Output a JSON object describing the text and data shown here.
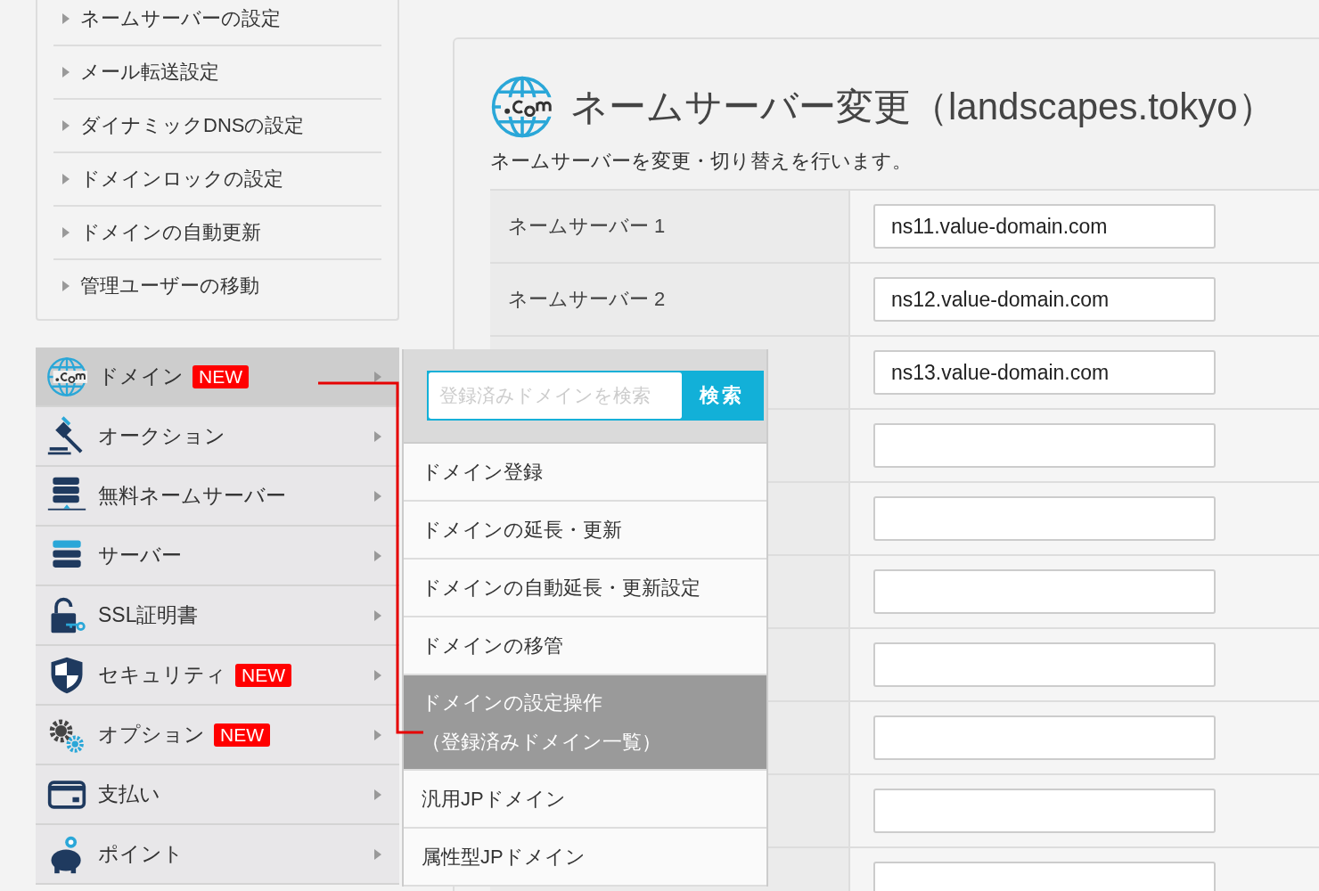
{
  "sidebar_links": [
    {
      "label": "ネームサーバーの設定"
    },
    {
      "label": "メール転送設定"
    },
    {
      "label": "ダイナミックDNSの設定"
    },
    {
      "label": "ドメインロックの設定"
    },
    {
      "label": "ドメインの自動更新"
    },
    {
      "label": "管理ユーザーの移動"
    }
  ],
  "main_menu": [
    {
      "label": "ドメイン",
      "badge": "NEW",
      "selected": true
    },
    {
      "label": "オークション",
      "selected": false
    },
    {
      "label": "無料ネームサーバー",
      "selected": false
    },
    {
      "label": "サーバー",
      "selected": false
    },
    {
      "label": "SSL証明書",
      "selected": false
    },
    {
      "label": "セキュリティ",
      "badge": "NEW",
      "selected": false
    },
    {
      "label": "オプション",
      "badge": "NEW",
      "selected": false
    },
    {
      "label": "支払い",
      "selected": false
    },
    {
      "label": "ポイント",
      "selected": false
    }
  ],
  "submenu": {
    "search": {
      "placeholder": "登録済みドメインを検索",
      "button": "検索"
    },
    "items": [
      {
        "label": "ドメイン登録",
        "selected": false
      },
      {
        "label": "ドメインの延長・更新",
        "selected": false
      },
      {
        "label": "ドメインの自動延長・更新設定",
        "selected": false
      },
      {
        "label": "ドメインの移管",
        "selected": false
      },
      {
        "label": "ドメインの設定操作",
        "note": "（登録済みドメイン一覧）",
        "selected": true
      },
      {
        "label": "汎用JPドメイン",
        "selected": false
      },
      {
        "label": "属性型JPドメイン",
        "selected": false
      }
    ]
  },
  "panel": {
    "title": "ネームサーバー変更（landscapes.tokyo）",
    "subtitle": "ネームサーバーを変更・切り替えを行います。",
    "rows": [
      {
        "label": "ネームサーバー 1",
        "value": "ns11.value-domain.com"
      },
      {
        "label": "ネームサーバー 2",
        "value": "ns12.value-domain.com"
      },
      {
        "value": "ns13.value-domain.com"
      },
      {},
      {},
      {},
      {},
      {},
      {},
      {}
    ]
  }
}
